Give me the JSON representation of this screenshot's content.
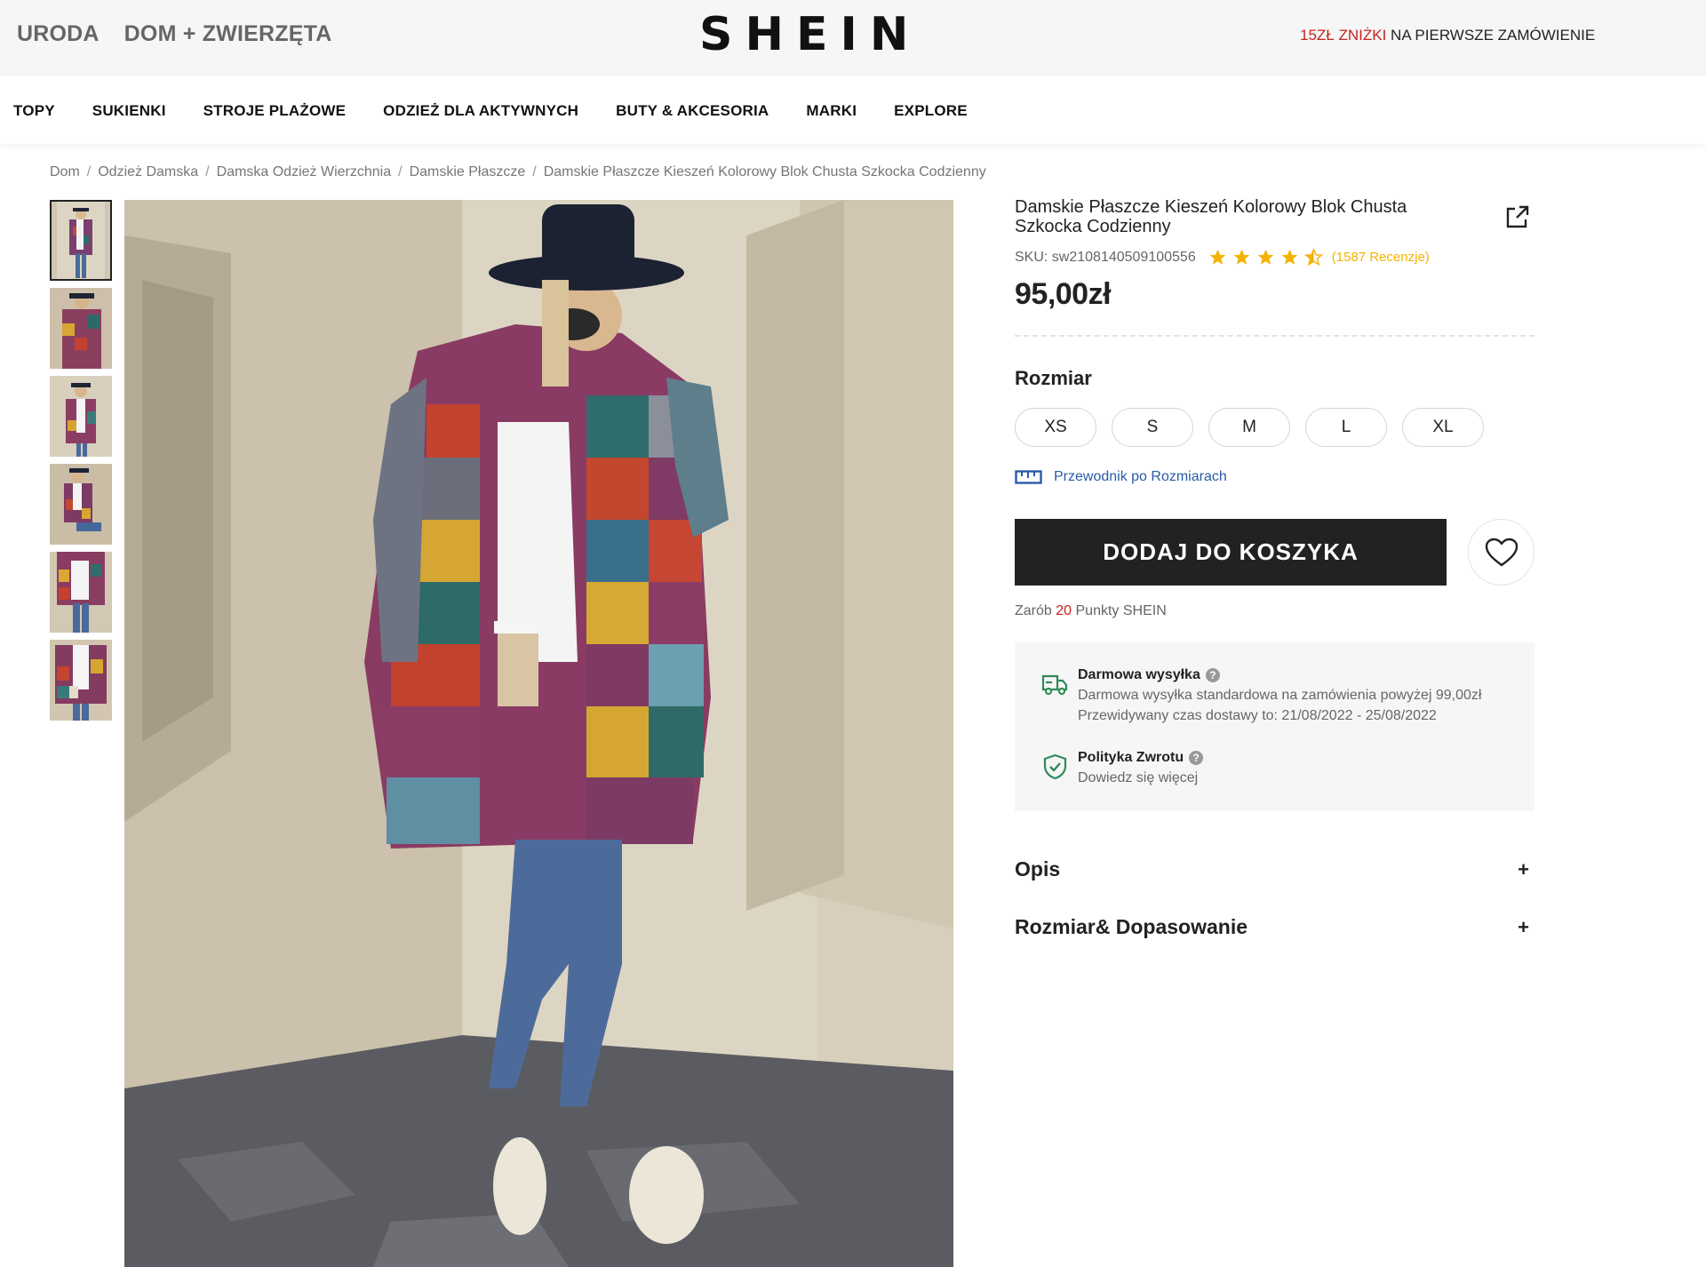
{
  "top_bar": {
    "categories": [
      "URODA",
      "DOM + ZWIERZĘTA"
    ],
    "logo": "SHEIN",
    "promo_highlight": "15ZŁ ZNIŻKI",
    "promo_rest": " NA PIERWSZE ZAMÓWIENIE"
  },
  "nav": {
    "items": [
      "TOPY",
      "SUKIENKI",
      "STROJE PLAŻOWE",
      "ODZIEŻ DLA AKTYWNYCH",
      "BUTY & AKCESORIA",
      "MARKI",
      "EXPLORE"
    ]
  },
  "breadcrumb": {
    "items": [
      "Dom",
      "Odzież Damska",
      "Damska Odzież Wierzchnia",
      "Damskie Płaszcze"
    ],
    "current": "Damskie Płaszcze Kieszeń Kolorowy Blok Chusta Szkocka Codzienny"
  },
  "gallery": {
    "thumbnail_count": 6,
    "active_index": 0
  },
  "product": {
    "title": "Damskie Płaszcze Kieszeń Kolorowy Blok Chusta Szkocka Codzienny",
    "sku": "SKU: sw2108140509100556",
    "rating": 4.5,
    "reviews": "(1587 Recenzje)",
    "price": "95,00zł",
    "size_label": "Rozmiar",
    "sizes": [
      "XS",
      "S",
      "M",
      "L",
      "XL"
    ],
    "size_guide": "Przewodnik po Rozmiarach",
    "add_to_cart": "DODAJ DO KOSZYKA",
    "points_prefix": "Zarób ",
    "points_value": "20",
    "points_suffix": " Punkty SHEIN"
  },
  "shipping": {
    "free_title": "Darmowa wysyłka",
    "free_line1": "Darmowa wysyłka standardowa na zamówienia powyżej 99,00zł",
    "free_line2": "Przewidywany czas dostawy to: 21/08/2022 - 25/08/2022",
    "return_title": "Polityka Zwrotu",
    "return_line": "Dowiedz się więcej",
    "help_glyph": "?"
  },
  "accordions": [
    {
      "label": "Opis",
      "icon": "+"
    },
    {
      "label": "Rozmiar& Dopasowanie",
      "icon": "+"
    }
  ],
  "colors": {
    "accent_red": "#c4231e",
    "star_yellow": "#f3b300",
    "link_blue": "#2a5aa8",
    "button_black": "#222222",
    "return_green": "#2e8b57"
  }
}
